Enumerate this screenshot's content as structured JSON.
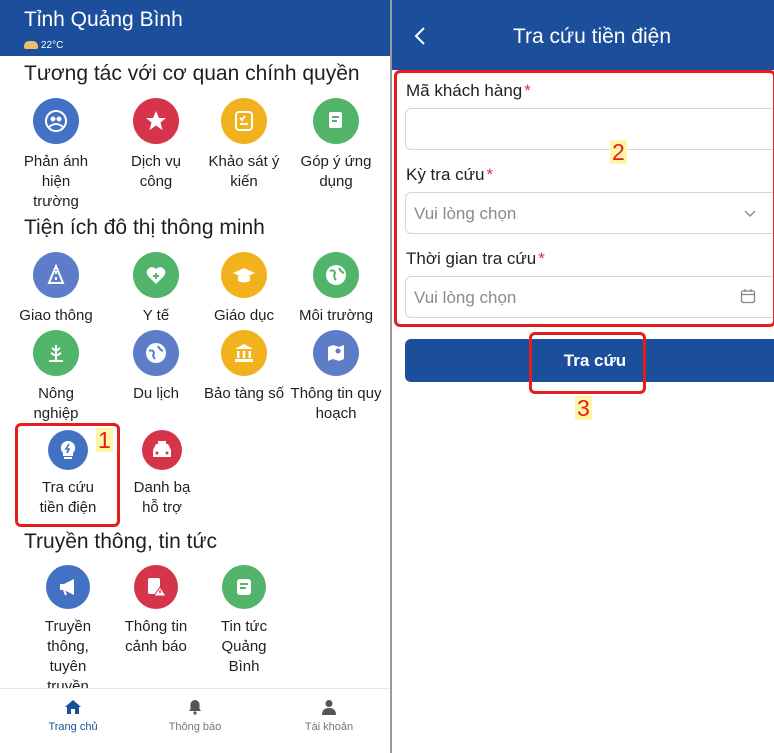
{
  "left": {
    "app_title": "Tỉnh Quảng Bình",
    "weather": "22°C",
    "sections": [
      {
        "title": "Tương tác với cơ quan chính quyền"
      },
      {
        "title": "Tiện ích đô thị thông minh"
      },
      {
        "title": "Truyền thông, tin tức"
      }
    ],
    "tiles": {
      "phan_anh": {
        "label": "Phản ánh hiện trường",
        "icon": "people-icon"
      },
      "dich_vu_cong": {
        "label": "Dịch vụ công",
        "icon": "services-icon"
      },
      "khao_sat": {
        "label": "Khảo sát ý kiến",
        "icon": "survey-icon"
      },
      "gop_y": {
        "label": "Góp ý ứng dụng",
        "icon": "feedback-icon"
      },
      "giao_thong": {
        "label": "Giao thông",
        "icon": "traffic-icon"
      },
      "y_te": {
        "label": "Y tế",
        "icon": "heart-plus-icon"
      },
      "giao_duc": {
        "label": "Giáo dục",
        "icon": "graduation-cap-icon"
      },
      "moi_truong": {
        "label": "Môi trường",
        "icon": "globe-icon"
      },
      "nong_nghiep": {
        "label": "Nông nghiệp",
        "icon": "rice-icon"
      },
      "du_lich": {
        "label": "Du lịch",
        "icon": "travel-globe-icon"
      },
      "bao_tang": {
        "label": "Bảo tàng số",
        "icon": "museum-icon"
      },
      "quy_hoach": {
        "label": "Thông tin quy hoạch",
        "icon": "map-icon"
      },
      "tien_dien": {
        "label": "Tra cứu tiền điện",
        "icon": "bulb-icon"
      },
      "danh_ba": {
        "label": "Danh bạ hỗ trợ",
        "icon": "taxi-icon"
      },
      "truyen_thong": {
        "label": "Truyền thông, tuyên truyền",
        "icon": "megaphone-icon"
      },
      "canh_bao": {
        "label": "Thông tin cảnh báo",
        "icon": "warning-doc-icon"
      },
      "tin_tuc": {
        "label": "Tin tức Quảng Bình",
        "icon": "news-icon"
      }
    },
    "nav": [
      {
        "label": "Trang chủ",
        "icon": "home-icon"
      },
      {
        "label": "Thông báo",
        "icon": "bell-icon"
      },
      {
        "label": "Tài khoản",
        "icon": "user-icon"
      }
    ]
  },
  "right": {
    "title": "Tra cứu tiền điện",
    "fields": {
      "customer_code": {
        "label": "Mã khách hàng",
        "required": "*",
        "value": ""
      },
      "period": {
        "label": "Kỳ tra cứu",
        "required": "*",
        "placeholder": "Vui lòng chọn"
      },
      "time": {
        "label": "Thời gian tra cứu",
        "required": "*",
        "placeholder": "Vui lòng chọn"
      }
    },
    "submit_label": "Tra cứu"
  },
  "annotations": {
    "one": "1",
    "two": "2",
    "three": "3"
  },
  "colors": {
    "primary": "#1b4e9b",
    "highlight": "#e51d1d",
    "required": "#d6344a"
  }
}
